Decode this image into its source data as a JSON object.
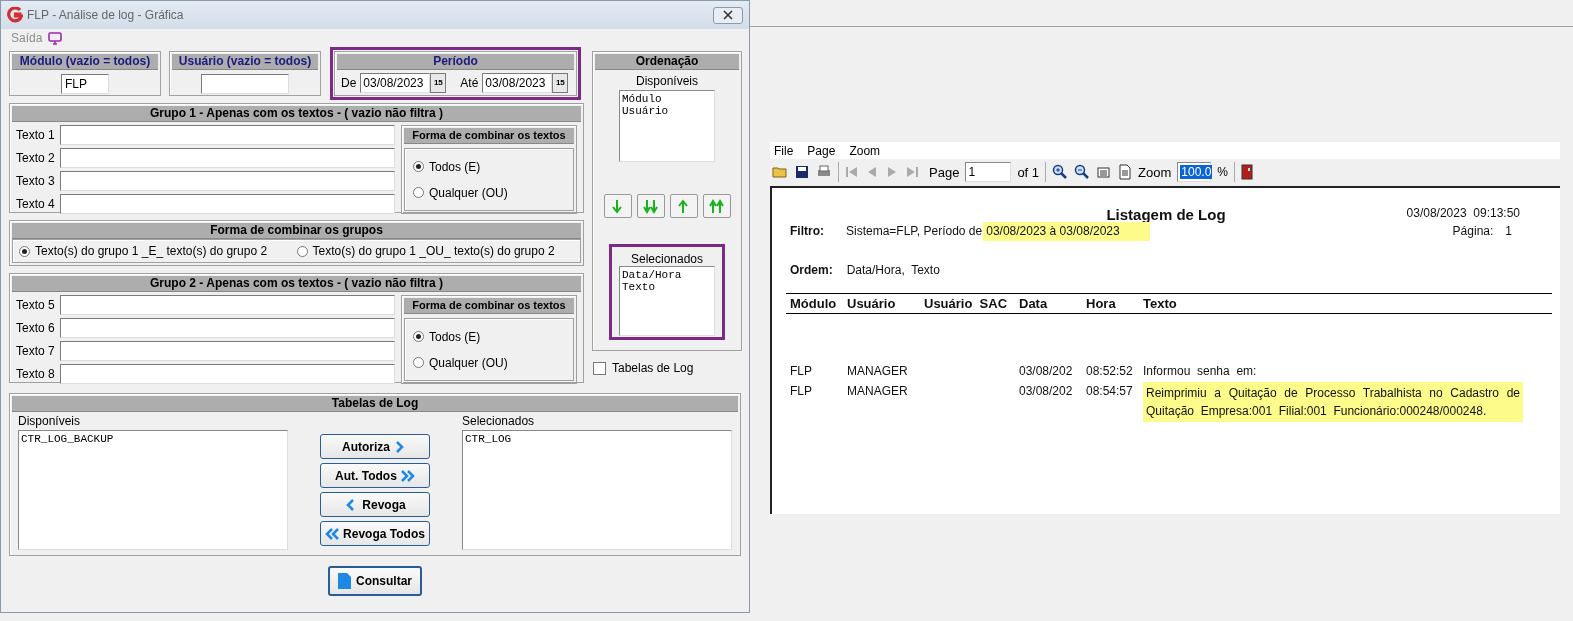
{
  "window": {
    "title": "FLP - Análise de log - Gráfica"
  },
  "menu": [
    {
      "label": "Saída",
      "disabled": true
    }
  ],
  "modulo": {
    "title": "Módulo (vazio = todos)",
    "value": "FLP"
  },
  "usuario": {
    "title": "Usuário (vazio = todos)"
  },
  "periodo": {
    "title": "Período",
    "annotated": true,
    "from_label": "De",
    "from": "03/08/2023",
    "from_picker": "15",
    "to_label": "Até",
    "to": "03/08/2023",
    "to_picker": "15"
  },
  "grupo1": {
    "title": "Grupo 1 - Apenas com os textos - ( vazio não filtra )",
    "fields": [
      {
        "label": "Texto 1"
      },
      {
        "label": "Texto 2"
      },
      {
        "label": "Texto 3"
      },
      {
        "label": "Texto 4"
      }
    ],
    "combine": {
      "title": "Forma de combinar os textos",
      "options": [
        {
          "label": "Todos (E)",
          "selected": true
        },
        {
          "label": "Qualquer (OU)",
          "selected": false
        }
      ]
    }
  },
  "grupos_combine": {
    "title": "Forma de combinar os grupos",
    "options": [
      {
        "label": "Texto(s) do grupo 1 _E_ texto(s) do grupo 2",
        "selected": true
      },
      {
        "label": "Texto(s) do grupo 1 _OU_ texto(s) do grupo 2",
        "selected": false
      }
    ]
  },
  "grupo2": {
    "title": "Grupo 2 - Apenas com os textos - ( vazio não filtra )",
    "fields": [
      {
        "label": "Texto 5"
      },
      {
        "label": "Texto 6"
      },
      {
        "label": "Texto 7"
      },
      {
        "label": "Texto 8"
      }
    ],
    "combine": {
      "title": "Forma de combinar os textos",
      "options": [
        {
          "label": "Todos (E)",
          "selected": true
        },
        {
          "label": "Qualquer (OU)",
          "selected": false
        }
      ]
    }
  },
  "ordenacao": {
    "title": "Ordenação",
    "available_label": "Disponíveis",
    "available": [
      "Módulo",
      "Usuário"
    ],
    "selected_label": "Selecionados",
    "selected_items": [
      "Data/Hora",
      "Texto"
    ],
    "annotated": true
  },
  "tabelas_option": {
    "label": "Tabelas de Log",
    "checked": false
  },
  "tabelas": {
    "title": "Tabelas de Log",
    "available_label": "Disponíveis",
    "available": [
      "CTR_LOG_BACKUP"
    ],
    "selected_label": "Selecionados",
    "selected_items": [
      "CTR_LOG"
    ],
    "buttons": [
      {
        "label": "Autoriza",
        "kind": "right"
      },
      {
        "label": "Aut. Todos",
        "kind": "all-right"
      },
      {
        "label": "Revoga",
        "kind": "left"
      },
      {
        "label": "Revoga Todos",
        "kind": "all-left"
      }
    ]
  },
  "consultar": "Consultar",
  "viewer": {
    "menu": [
      "File",
      "Page",
      "Zoom"
    ],
    "page_label": "Page",
    "page": "1",
    "page_of": "of 1",
    "zoom_label": "Zoom",
    "zoom": "100.0",
    "percent": "%",
    "report": {
      "title": "Listagem de Log",
      "datetime": "03/08/2023  09:13:50",
      "filter_label": "Filtro:",
      "filter_text": "Sistema=FLP, Período de",
      "filter_period": {
        "text": "03/08/2023 à 03/08/2023",
        "highlighted": true
      },
      "page_label": "Página:",
      "page": "1",
      "order_label": "Ordem:",
      "order": "Data/Hora,  Texto",
      "columns": [
        "Módulo",
        "Usuário",
        "Usuário  SAC",
        "Data",
        "Hora",
        "Texto"
      ],
      "rows": [
        {
          "cells": [
            "FLP",
            "MANAGER",
            "",
            "03/08/202",
            "08:52:52",
            "Informou  senha  em:"
          ],
          "highlighted": false
        },
        {
          "cells": [
            "FLP",
            "MANAGER",
            "",
            "03/08/202",
            "08:54:57",
            "Reimprimiu a Quitação de Processo Trabalhista no Cadastro de Quitação  Empresa:001  Filial:001  Funcionário:000248/000248."
          ],
          "highlighted": true
        }
      ]
    }
  }
}
